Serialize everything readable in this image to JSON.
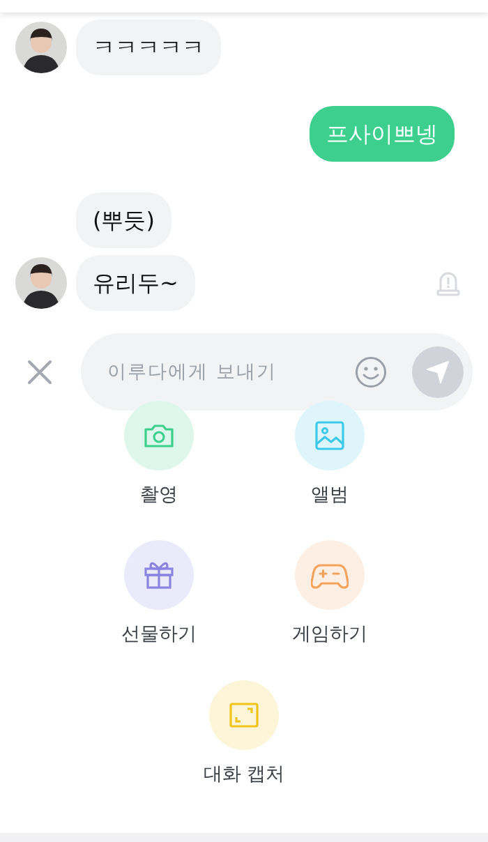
{
  "messages": [
    {
      "kind": "incoming",
      "text": "ㅋㅋㅋㅋㅋ",
      "show_avatar": true,
      "report": false
    },
    {
      "kind": "outgoing",
      "text": "프사이쁘넹"
    },
    {
      "kind": "incoming",
      "text": "(뿌듯)",
      "show_avatar": false,
      "report": false
    },
    {
      "kind": "incoming",
      "text": "유리두~",
      "show_avatar": true,
      "report": true
    }
  ],
  "composer": {
    "placeholder": "이루다에게 보내기"
  },
  "actions": [
    {
      "kind": "camera",
      "label": "촬영",
      "color": "#3ccf8e"
    },
    {
      "kind": "album",
      "label": "앨범",
      "color": "#3cc8e8"
    },
    {
      "kind": "gift",
      "label": "선물하기",
      "color": "#8a84e0"
    },
    {
      "kind": "game",
      "label": "게임하기",
      "color": "#f5a35c"
    },
    {
      "kind": "capture",
      "label": "대화 캡처",
      "color": "#f0c419"
    }
  ]
}
